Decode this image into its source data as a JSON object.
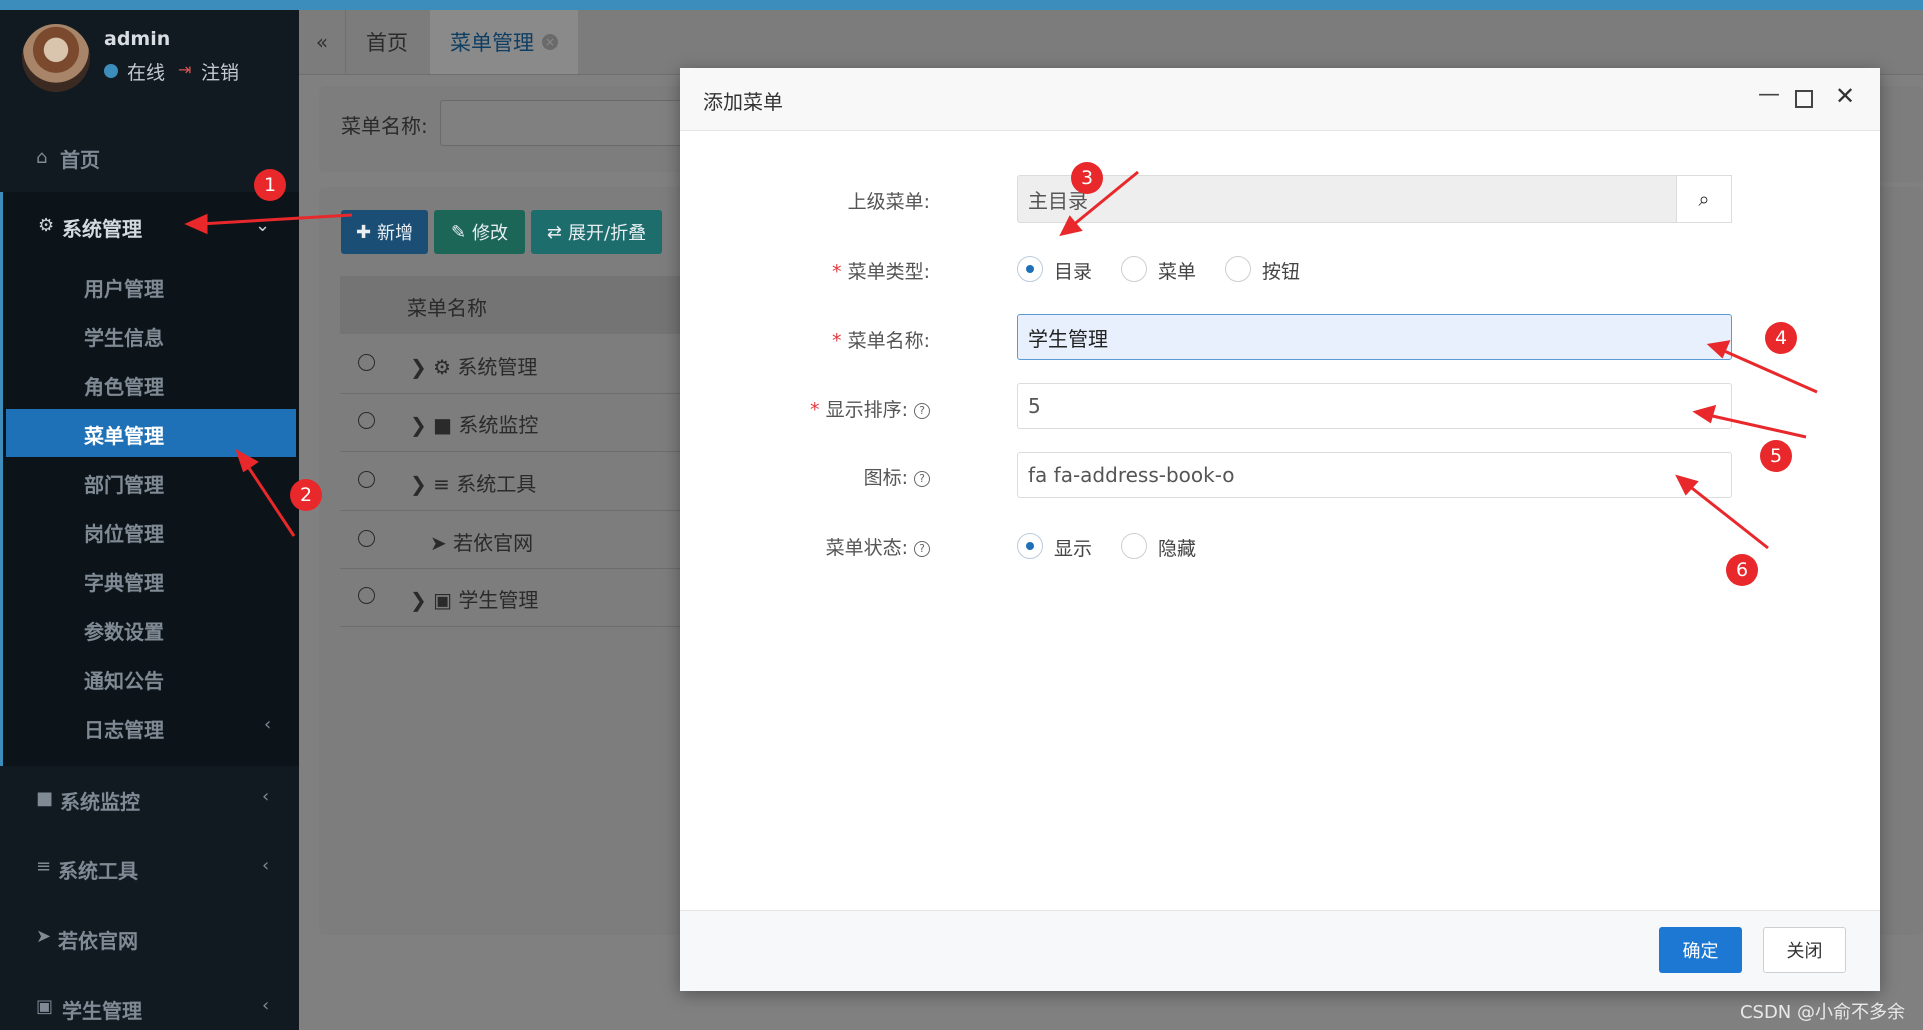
{
  "user": {
    "name": "admin",
    "status": "在线",
    "logout": "注销"
  },
  "sidebar": {
    "home": "首页",
    "system": "系统管理",
    "system_items": [
      "用户管理",
      "学生信息",
      "角色管理",
      "菜单管理",
      "部门管理",
      "岗位管理",
      "字典管理",
      "参数设置",
      "通知公告",
      "日志管理"
    ],
    "monitor": "系统监控",
    "tools": "系统工具",
    "official": "若依官网",
    "student": "学生管理"
  },
  "tabs": {
    "home": "首页",
    "active": "菜单管理"
  },
  "search": {
    "label": "菜单名称:"
  },
  "toolbar": {
    "add": "新增",
    "edit": "修改",
    "toggle": "展开/折叠"
  },
  "table": {
    "header": "菜单名称",
    "rows": [
      "系统管理",
      "系统监控",
      "系统工具",
      "若依官网",
      "学生管理"
    ]
  },
  "modal": {
    "title": "添加菜单",
    "parent_label": "上级菜单:",
    "parent_value": "主目录",
    "type_label": "菜单类型:",
    "type_options": [
      "目录",
      "菜单",
      "按钮"
    ],
    "type_selected": "目录",
    "name_label": "菜单名称:",
    "name_value": "学生管理",
    "order_label": "显示排序:",
    "order_value": "5",
    "icon_label": "图标:",
    "icon_value": "fa fa-address-book-o",
    "status_label": "菜单状态:",
    "status_options": [
      "显示",
      "隐藏"
    ],
    "status_selected": "显示",
    "confirm": "确定",
    "close": "关闭"
  },
  "annotations": [
    "1",
    "2",
    "3",
    "4",
    "5",
    "6"
  ],
  "watermark": "CSDN @小俞不多余",
  "colors": {
    "accent": "#1e71b6",
    "annotation": "#e8282a",
    "sidebar_bg": "#111a21"
  }
}
